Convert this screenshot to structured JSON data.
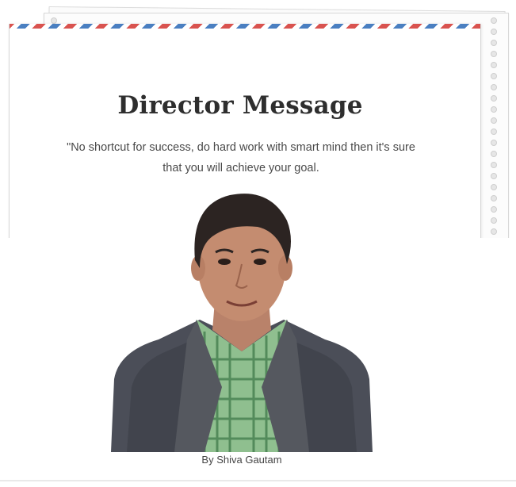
{
  "message": {
    "title": "Director Message",
    "quote": "\"No shortcut for success, do hard work with smart mind then it's sure that you will achieve your goal.",
    "caption": "By Shiva Gautam"
  },
  "colors": {
    "airmail_red": "#d9534f",
    "airmail_blue": "#4a7fc1",
    "title_text": "#2e2e2e",
    "body_text": "#4a4a4a"
  }
}
